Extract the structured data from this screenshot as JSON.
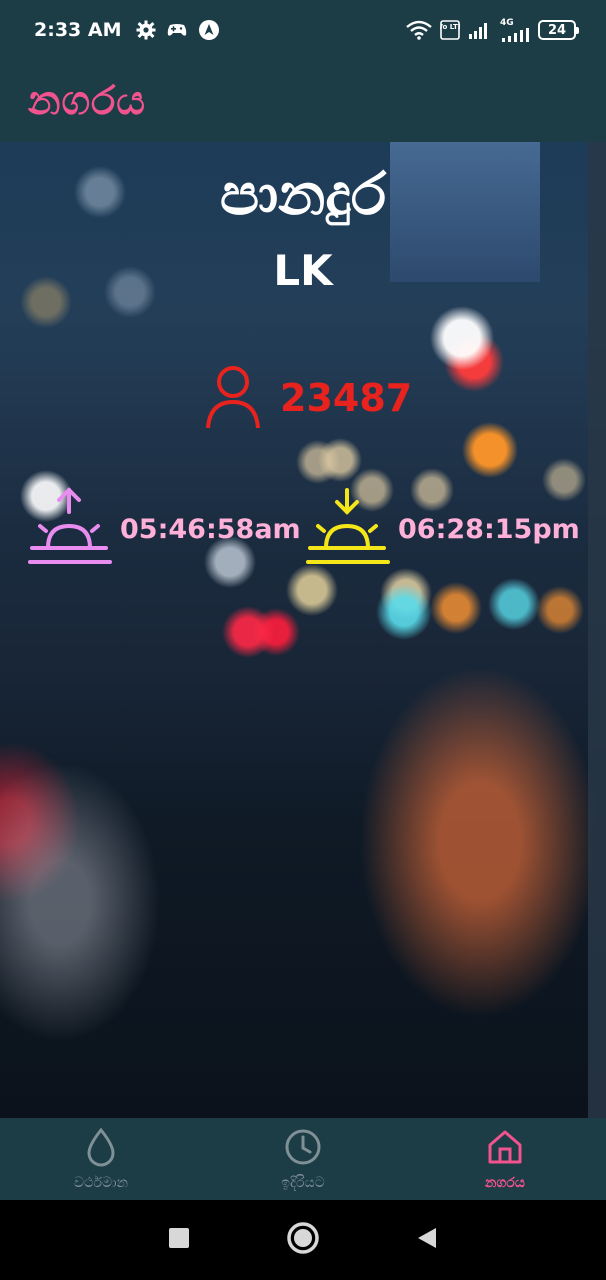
{
  "status_bar": {
    "time": "2:33 AM",
    "icons": [
      "settings-icon",
      "gamepad-icon",
      "nav-arrow-icon",
      "wifi-icon",
      "volte-icon",
      "signal-icon",
      "4g-signal-icon"
    ],
    "volte_label": "Vo LTE",
    "network_label": "4G",
    "battery_level": "24"
  },
  "app_bar": {
    "title": "නගරය"
  },
  "city": {
    "name": "පානදුර",
    "country": "LK",
    "population": "23487",
    "sunrise": "05:46:58am",
    "sunset": "06:28:15pm"
  },
  "colors": {
    "accent": "#f0538d",
    "bar": "#1c3c46",
    "population": "#e8231e",
    "sunrise_icon": "#e88cf0",
    "sunset_icon": "#f5e61a",
    "sun_time_text": "#ffb0d8"
  },
  "bottom_nav": {
    "items": [
      {
        "label": "වර්ථමාන",
        "icon": "drop-icon",
        "active": false
      },
      {
        "label": "ඉදිරියට",
        "icon": "clock-icon",
        "active": false
      },
      {
        "label": "නගරය",
        "icon": "home-icon",
        "active": true
      }
    ]
  },
  "system_nav": [
    "recents-icon",
    "home-circle-icon",
    "back-icon"
  ]
}
